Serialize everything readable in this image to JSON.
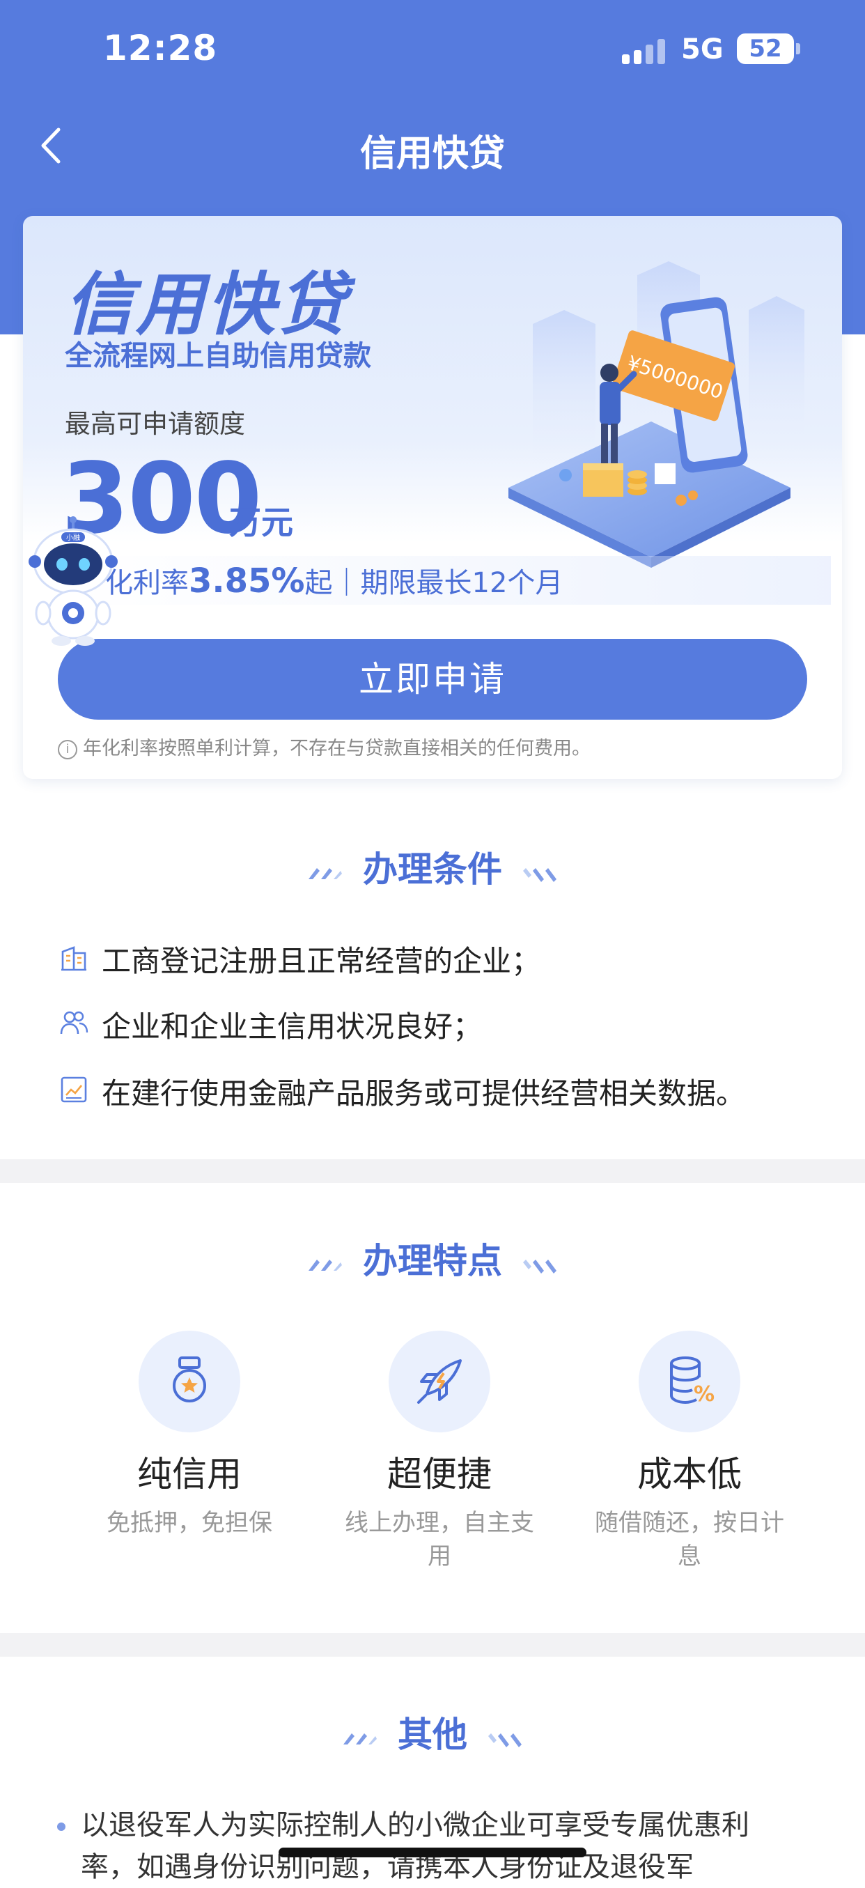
{
  "status_bar": {
    "time": "12:28",
    "network": "5G",
    "battery": "52"
  },
  "nav": {
    "title": "信用快贷"
  },
  "hero": {
    "title": "信用快贷",
    "subtitle": "全流程网上自助信用贷款",
    "limit_label": "最高可申请额度",
    "amount": "300",
    "amount_unit": "万元",
    "rate_prefix": "化利率",
    "rate_value": "3.85%",
    "rate_suffix": "起｜期限最长12个月",
    "illustration_amount": "¥5000000",
    "robot_badge": "小融",
    "apply_button": "立即申请",
    "disclaimer": "年化利率按照单利计算，不存在与贷款直接相关的任何费用。"
  },
  "conditions": {
    "title": "办理条件",
    "items": [
      {
        "icon": "building-icon",
        "text": "工商登记注册且正常经营的企业；"
      },
      {
        "icon": "users-icon",
        "text": "企业和企业主信用状况良好；"
      },
      {
        "icon": "data-chart-icon",
        "text": "在建行使用金融产品服务或可提供经营相关数据。"
      }
    ]
  },
  "features": {
    "title": "办理特点",
    "items": [
      {
        "icon": "medal-icon",
        "title": "纯信用",
        "desc": "免抵押，免担保"
      },
      {
        "icon": "rocket-icon",
        "title": "超便捷",
        "desc": "线上办理，自主支用"
      },
      {
        "icon": "coins-percent-icon",
        "title": "成本低",
        "desc": "随借随还，按日计息"
      }
    ]
  },
  "other": {
    "title": "其他",
    "items": [
      {
        "text": "以退役军人为实际控制人的小微企业可享受专属优惠利率，如遇身份识别问题，请携本人身份证及退役军"
      }
    ]
  },
  "colors": {
    "brand": "#567BDE",
    "brand_text": "#4B6FD6",
    "accent_orange": "#F5A445"
  }
}
